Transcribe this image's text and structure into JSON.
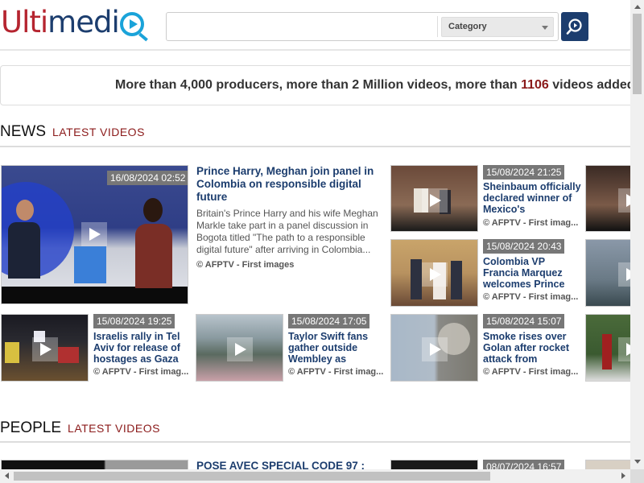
{
  "header": {
    "logo": {
      "part1": "Ulti",
      "part2": "medi",
      "part3": ""
    },
    "search": {
      "value": "",
      "placeholder": ""
    },
    "category": {
      "selected": "Category"
    }
  },
  "stats": {
    "prefix": "More than 4,000 producers, more than 2 Million videos, more than ",
    "count": "1106",
    "suffix": " videos added"
  },
  "sections": [
    {
      "title": "NEWS",
      "subtitle": "LATEST VIDEOS"
    },
    {
      "title": "PEOPLE",
      "subtitle": "LATEST VIDEOS"
    }
  ],
  "news": {
    "featured": {
      "date": "16/08/2024 02:52",
      "title": "Prince Harry, Meghan join panel in Colombia on responsible digital future",
      "description": "Britain's Prince Harry and his wife Meghan Markle take part in a panel discussion in Bogota titled \"The path to a responsible digital future\" after arriving in Colombia...",
      "credit": "© AFPTV - First images"
    },
    "cards": [
      {
        "date": "15/08/2024 21:25",
        "title": "Sheinbaum officially declared winner of Mexico's president...",
        "credit": "© AFPTV - First imag..."
      },
      {
        "date": "15/08/2024 20:43",
        "title": "Colombia VP Francia Marquez welcomes Prince Harry and...",
        "credit": "© AFPTV - First imag..."
      },
      {
        "date": "15/08/2024 19:25",
        "title": "Israelis rally in Tel Aviv for release of hostages as Gaza t...",
        "credit": "© AFPTV - First imag..."
      },
      {
        "date": "15/08/2024 17:05",
        "title": "Taylor Swift fans gather outside Wembley as singer...",
        "credit": "© AFPTV - First imag..."
      },
      {
        "date": "15/08/2024 15:07",
        "title": "Smoke rises over Golan after rocket attack from Lebanon",
        "credit": "© AFPTV - First imag..."
      }
    ]
  },
  "people": {
    "featured": {
      "title": "POSE AVEC SPECIAL CODE 97 :"
    },
    "cards": [
      {
        "date": "08/07/2024 16:57"
      }
    ]
  }
}
